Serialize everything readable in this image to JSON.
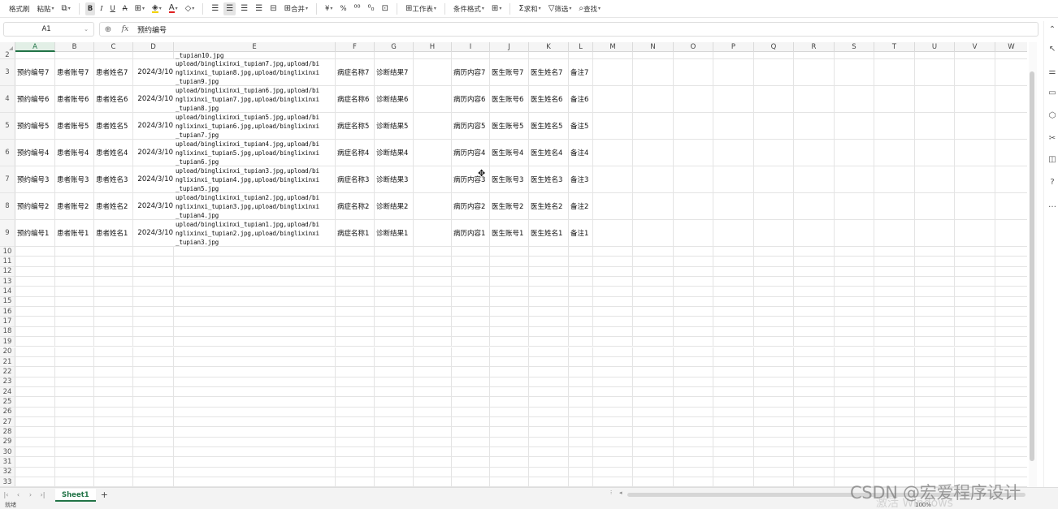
{
  "toolbar": {
    "format_painter": "格式刷",
    "paste": "粘贴",
    "paste_caret": "▾",
    "copy_icon": "copy-icon",
    "bold": "B",
    "italic": "I",
    "underline": "U",
    "strikethrough": "A",
    "border": "⊞",
    "fill_color": "◈",
    "font_color": "A",
    "clear": "◇",
    "merge": "合并",
    "currency": "¥",
    "percent": "%",
    "worksheet": "工作表",
    "conditional_format": "条件格式",
    "sum": "求和",
    "filter": "筛选",
    "find": "查找"
  },
  "formula_bar": {
    "cell_ref": "A1",
    "content": "预约编号"
  },
  "columns": [
    "A",
    "B",
    "C",
    "D",
    "E",
    "F",
    "G",
    "H",
    "I",
    "J",
    "K",
    "L",
    "M",
    "N",
    "O",
    "P",
    "Q",
    "R",
    "S",
    "T",
    "U",
    "V",
    "W"
  ],
  "row2_tail": "_tupian10.jpg",
  "rows": [
    {
      "num": "3",
      "a": "预约编号7",
      "b": "患者账号7",
      "c": "患者姓名7",
      "d": "2024/3/10",
      "e": "upload/binglixinxi_tupian7.jpg,upload/bi\nnglixinxi_tupian8.jpg,upload/binglixinxi\n_tupian9.jpg",
      "f": "病症名称7",
      "g": "诊断结果7",
      "i": "病历内容7",
      "j": "医生账号7",
      "k": "医生姓名7",
      "l": "备注7"
    },
    {
      "num": "4",
      "a": "预约编号6",
      "b": "患者账号6",
      "c": "患者姓名6",
      "d": "2024/3/10",
      "e": "upload/binglixinxi_tupian6.jpg,upload/bi\nnglixinxi_tupian7.jpg,upload/binglixinxi\n_tupian8.jpg",
      "f": "病症名称6",
      "g": "诊断结果6",
      "i": "病历内容6",
      "j": "医生账号6",
      "k": "医生姓名6",
      "l": "备注6"
    },
    {
      "num": "5",
      "a": "预约编号5",
      "b": "患者账号5",
      "c": "患者姓名5",
      "d": "2024/3/10",
      "e": "upload/binglixinxi_tupian5.jpg,upload/bi\nnglixinxi_tupian6.jpg,upload/binglixinxi\n_tupian7.jpg",
      "f": "病症名称5",
      "g": "诊断结果5",
      "i": "病历内容5",
      "j": "医生账号5",
      "k": "医生姓名5",
      "l": "备注5"
    },
    {
      "num": "6",
      "a": "预约编号4",
      "b": "患者账号4",
      "c": "患者姓名4",
      "d": "2024/3/10",
      "e": "upload/binglixinxi_tupian4.jpg,upload/bi\nnglixinxi_tupian5.jpg,upload/binglixinxi\n_tupian6.jpg",
      "f": "病症名称4",
      "g": "诊断结果4",
      "i": "病历内容4",
      "j": "医生账号4",
      "k": "医生姓名4",
      "l": "备注4"
    },
    {
      "num": "7",
      "a": "预约编号3",
      "b": "患者账号3",
      "c": "患者姓名3",
      "d": "2024/3/10",
      "e": "upload/binglixinxi_tupian3.jpg,upload/bi\nnglixinxi_tupian4.jpg,upload/binglixinxi\n_tupian5.jpg",
      "f": "病症名称3",
      "g": "诊断结果3",
      "i": "病历内容3",
      "j": "医生账号3",
      "k": "医生姓名3",
      "l": "备注3"
    },
    {
      "num": "8",
      "a": "预约编号2",
      "b": "患者账号2",
      "c": "患者姓名2",
      "d": "2024/3/10",
      "e": "upload/binglixinxi_tupian2.jpg,upload/bi\nnglixinxi_tupian3.jpg,upload/binglixinxi\n_tupian4.jpg",
      "f": "病症名称2",
      "g": "诊断结果2",
      "i": "病历内容2",
      "j": "医生账号2",
      "k": "医生姓名2",
      "l": "备注2"
    },
    {
      "num": "9",
      "a": "预约编号1",
      "b": "患者账号1",
      "c": "患者姓名1",
      "d": "2024/3/10",
      "e": "upload/binglixinxi_tupian1.jpg,upload/bi\nnglixinxi_tupian2.jpg,upload/binglixinxi\n_tupian3.jpg",
      "f": "病症名称1",
      "g": "诊断结果1",
      "i": "病历内容1",
      "j": "医生账号1",
      "k": "医生姓名1",
      "l": "备注1"
    }
  ],
  "empty_rows": [
    "10",
    "11",
    "12",
    "13",
    "14",
    "15",
    "16",
    "17",
    "18",
    "19",
    "20",
    "21",
    "22",
    "23",
    "24",
    "25",
    "26",
    "27",
    "28",
    "29",
    "30",
    "31",
    "32",
    "33"
  ],
  "sheet_tab": "Sheet1",
  "add_sheet": "+",
  "watermark": "CSDN @宏爱程序设计",
  "watermark_sub": "激活 Windows",
  "status": {
    "left": "就绪",
    "zoom": "100%"
  },
  "colors": {
    "accent": "#217346",
    "header_bg": "#f5f5f5",
    "grid": "#e4e4e4"
  }
}
